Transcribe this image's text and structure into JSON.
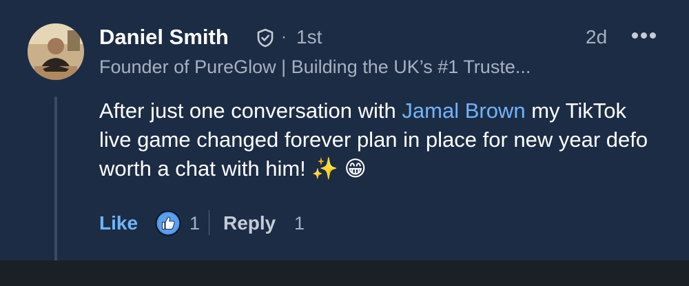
{
  "comment": {
    "author": {
      "name": "Daniel Smith",
      "badge": "verified-shield-icon",
      "separator": "·",
      "degree": "1st",
      "headline": "Founder of PureGlow | Building the UK’s #1 Truste..."
    },
    "timestamp": "2d",
    "menu_icon": "more-horizontal-icon",
    "body": {
      "before_mention": "After just one conversation with ",
      "mention": "Jamal Brown",
      "after_mention": " my TikTok live game changed forever plan in place for new year defo worth a chat with him!",
      "emojis": "✨ 😁"
    },
    "actions": {
      "like_label": "Like",
      "like_icon": "thumbs-up-icon",
      "like_count": "1",
      "reply_label": "Reply",
      "reply_count": "1"
    }
  },
  "colors": {
    "background": "#1d2c45",
    "accent": "#70b5f9",
    "muted_text": "#a7b1c0",
    "bottom_bar": "#1b1f26"
  }
}
